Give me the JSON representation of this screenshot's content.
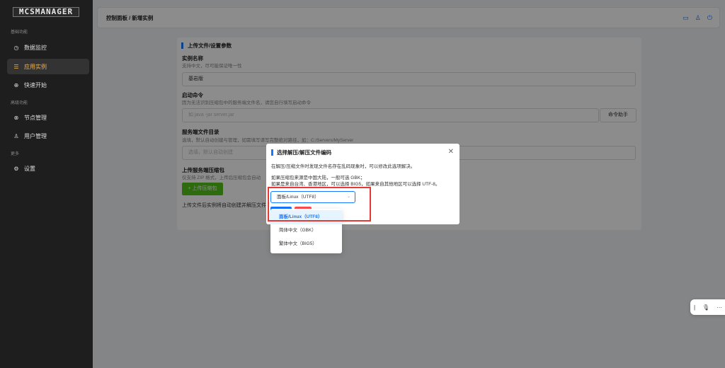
{
  "sidebar": {
    "logo": "MCSMANAGER",
    "sections": [
      "基础功能",
      "高级功能",
      "更多"
    ],
    "items": [
      {
        "label": "数据监控"
      },
      {
        "label": "应用实例"
      },
      {
        "label": "快速开始"
      },
      {
        "label": "节点管理"
      },
      {
        "label": "用户管理"
      },
      {
        "label": "设置"
      }
    ]
  },
  "topbar": {
    "breadcrumb": "控制面板 / 新增实例"
  },
  "form": {
    "title": "上传文件/设置参数",
    "name_label": "实例名称",
    "name_desc": "支持中文，尽可能保证唯一性",
    "name_value": "基岩版",
    "cmd_label": "启动命令",
    "cmd_desc": "因为无法识别压缩包中的服务端文件名，请您自行填写启动命令",
    "cmd_placeholder": "如 java -jar server.jar",
    "cmd_helper": "命令助手",
    "dir_label": "服务端文件目录",
    "dir_desc": "选填，默认自动创建与管理，如需填写请写完整绝对路径，如：C:/Servers/MyServer",
    "dir_placeholder": "选填，默认自动创建",
    "upload_label": "上传服务端压缩包",
    "upload_desc": "仅支持 ZIP 格式，上传后压缩包会自动",
    "upload_button": "+ 上传压缩包",
    "footer_note": "上传文件后实例将自动创建并解压文件"
  },
  "modal": {
    "title": "选择解压/解压文件编码",
    "line1": "在解压/压缩文件时发现文件名存在乱码现象时，可以修改此选项解决。",
    "line2": "如果压缩包来源是中国大陆，一般可选 GBK；",
    "line3": "如果是来自台湾、香港地区，可以选择 BIG5，如果来自其他地区可以选择 UTF-8。",
    "select_value": "面板/Linux（UTF8）",
    "options": [
      "面板/Linux（UTF8）",
      "简体中文（GBK）",
      "繁体中文（BIG5）"
    ]
  }
}
